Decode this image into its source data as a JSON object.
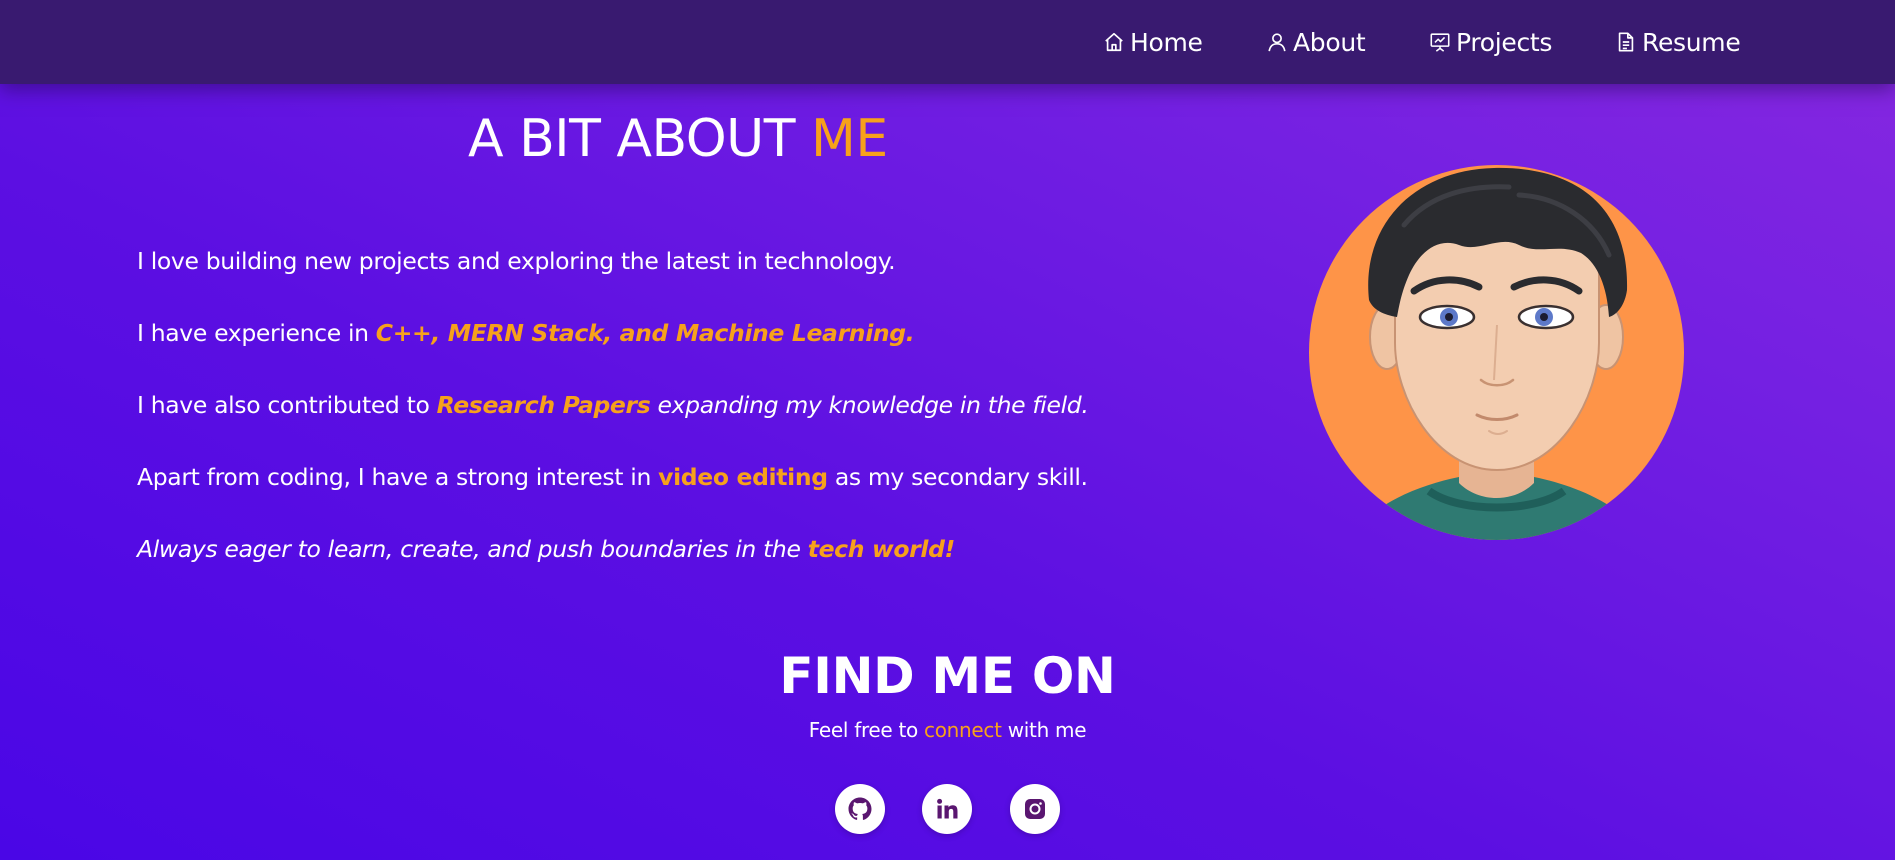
{
  "nav": {
    "items": [
      {
        "label": "Home",
        "icon": "home-icon"
      },
      {
        "label": "About",
        "icon": "user-icon"
      },
      {
        "label": "Projects",
        "icon": "presentation-icon"
      },
      {
        "label": "Resume",
        "icon": "document-icon"
      }
    ]
  },
  "about": {
    "title_main": "A BIT ABOUT",
    "title_accent": "ME",
    "p1": "I love building new projects and exploring the latest in technology.",
    "p2_pre": "I have experience in ",
    "p2_hl": "C++, MERN Stack, and Machine Learning.",
    "p3_pre": "I have also contributed to ",
    "p3_hl": "Research Papers",
    "p3_post": " expanding my knowledge in the field.",
    "p4_pre": "Apart from coding, I have a strong interest in ",
    "p4_hl": "video editing",
    "p4_post": " as my secondary skill.",
    "p5_pre": "Always eager to learn, create, and push boundaries in the ",
    "p5_hl": "tech world!"
  },
  "avatar": {
    "icon": "avatar-illustration"
  },
  "find": {
    "title": "FIND ME ON",
    "sub_pre": "Feel free to ",
    "sub_link": "connect",
    "sub_post": " with me"
  },
  "social": [
    {
      "icon": "github-icon"
    },
    {
      "icon": "linkedin-icon"
    },
    {
      "icon": "instagram-icon"
    }
  ],
  "colors": {
    "accent": "#f7a11b",
    "nav_bg": "#391a70",
    "bg_start": "#4a06e6",
    "bg_end": "#8728e0",
    "avatar_bg": "#fe9448",
    "social_icon": "#5a1670"
  }
}
